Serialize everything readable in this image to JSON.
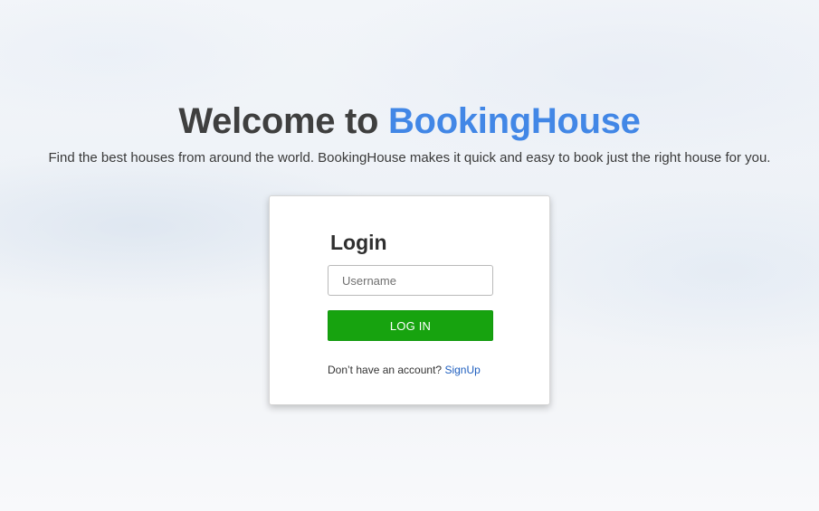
{
  "hero": {
    "title_prefix": "Welcome to ",
    "title_brand": "BookingHouse",
    "subtitle": "Find the best houses from around the world. BookingHouse makes it quick and easy to book just the right house for you."
  },
  "login": {
    "heading": "Login",
    "username_placeholder": "Username",
    "username_value": "",
    "button_label": "LOG IN",
    "signup_prompt": "Don’t have an account?",
    "signup_link": "SignUp"
  },
  "colors": {
    "brand": "#4287e6",
    "button": "#17a30f",
    "link": "#1f5fbf"
  }
}
